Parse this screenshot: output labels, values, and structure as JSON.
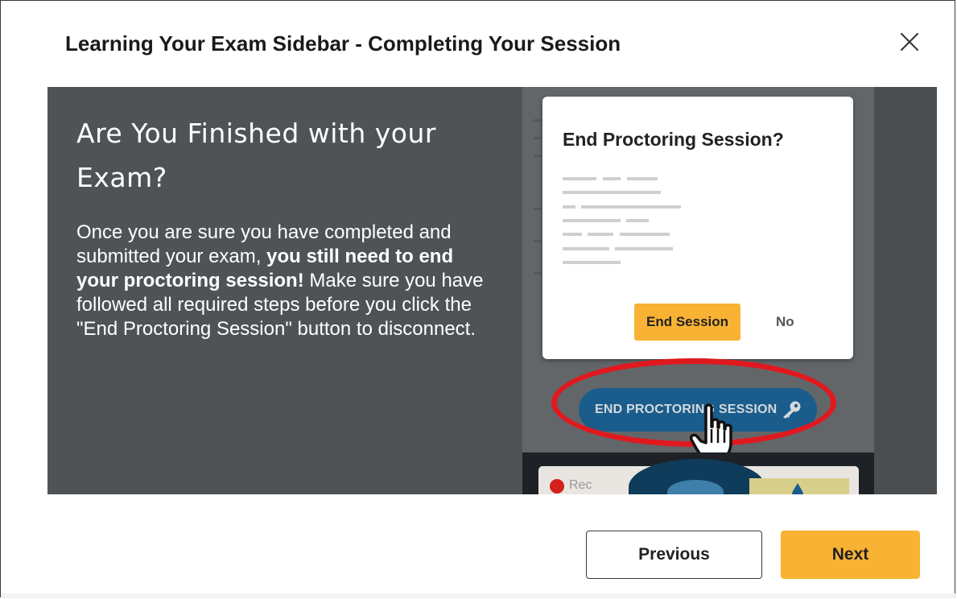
{
  "modal": {
    "title": "Learning Your Exam Sidebar - Completing Your Session",
    "close_icon": "close-icon"
  },
  "banner": {
    "heading": "Are You Finished with your Exam?",
    "body_part1": "Once you are sure you have completed and submitted your exam, ",
    "body_bold": "you still need to end your proctoring session!",
    "body_part2": " Make sure you have followed all required steps before you click the \"End Proctoring Session\" button to disconnect."
  },
  "illustration": {
    "dialog_title": "End Proctoring Session?",
    "end_session_label": "End Session",
    "no_label": "No",
    "end_proctoring_label": "END PROCTORING SESSION",
    "rec_label": "Rec",
    "key_icon": "key-icon",
    "pointer_icon": "hand-pointer-icon",
    "highlight_color": "#e0191f"
  },
  "footer": {
    "previous_label": "Previous",
    "next_label": "Next"
  },
  "colors": {
    "accent": "#f9b233",
    "banner_bg": "#4f5356",
    "sidebar_button": "#1a5d8c"
  }
}
